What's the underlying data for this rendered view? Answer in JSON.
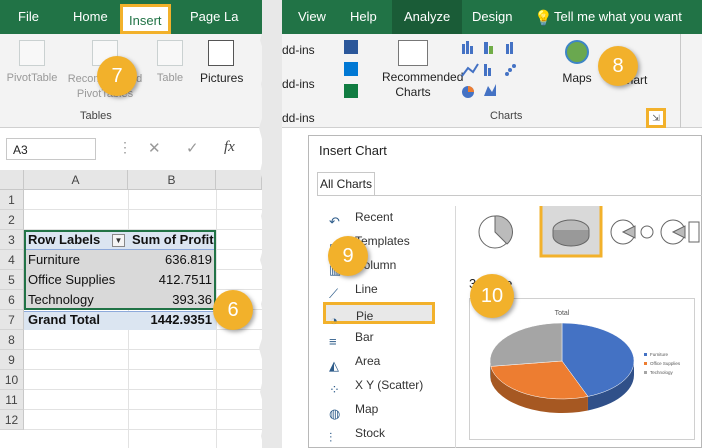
{
  "left": {
    "tabs": [
      "File",
      "Home",
      "Insert",
      "Page La"
    ],
    "ribbon_buttons": [
      "PivotTable",
      "Recommended PivotTables",
      "Table",
      "Pictures"
    ],
    "ribbon_group": "Tables",
    "name_box": "A3",
    "formula_icons": [
      "⋮",
      "✕",
      "✓",
      "fx"
    ],
    "columns": [
      "A",
      "B"
    ],
    "rows": [
      "1",
      "2",
      "3",
      "4",
      "5",
      "6",
      "7",
      "8",
      "9",
      "10",
      "11",
      "12"
    ],
    "pivot": {
      "header_labels": "Row Labels",
      "header_values": "Sum of Profit",
      "rows": [
        {
          "label": "Furniture",
          "value": "636.819"
        },
        {
          "label": "Office Supplies",
          "value": "412.7511"
        },
        {
          "label": "Technology",
          "value": "393.36"
        }
      ],
      "total_label": "Grand Total",
      "total_value": "1442.9351"
    }
  },
  "right": {
    "tabs": [
      "View",
      "Help",
      "Analyze",
      "Design",
      "Tell me what you want"
    ],
    "addins": [
      "dd-ins",
      "dd-ins",
      "dd-ins"
    ],
    "recommended_charts": "Recommended Charts",
    "maps": "Maps",
    "pivotchart_fragment": "hart",
    "charts_group": "Charts",
    "dialog": {
      "title": "Insert Chart",
      "tab": "All Charts",
      "chart_types": [
        "Recent",
        "Templates",
        "Column",
        "Line",
        "Pie",
        "Bar",
        "Area",
        "X Y (Scatter)",
        "Map",
        "Stock"
      ],
      "selected": "Pie",
      "preview_heading": "3-D Pie",
      "preview_title": "Total",
      "legend": [
        "Furniture",
        "Office Supplies",
        "Technology"
      ]
    }
  },
  "callouts": [
    "7",
    "6",
    "8",
    "9",
    "10"
  ],
  "colors": {
    "excel_green": "#217346",
    "callout": "#f2b12b",
    "series1": "#4472c4",
    "series2": "#ed7d31",
    "series3": "#a5a5a5"
  },
  "chart_data": {
    "type": "pie",
    "title": "Total",
    "categories": [
      "Furniture",
      "Office Supplies",
      "Technology"
    ],
    "values": [
      636.819,
      412.7511,
      393.36
    ]
  }
}
